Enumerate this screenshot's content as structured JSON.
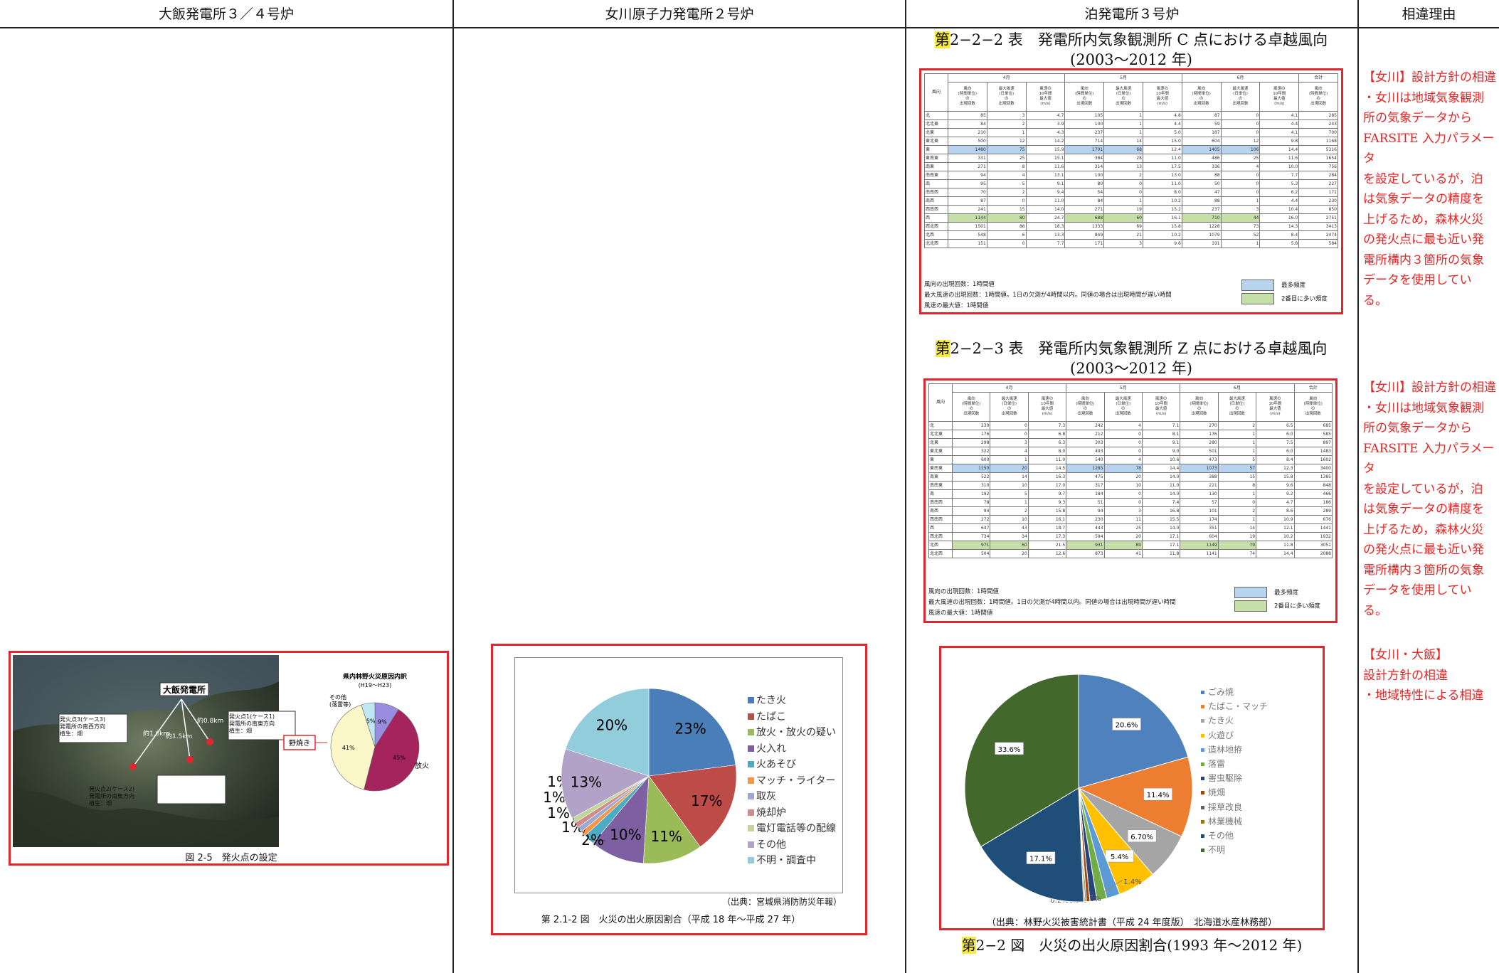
{
  "header": {
    "col1": "大飯発電所３／４号炉",
    "col2": "女川原子力発電所２号炉",
    "col3": "泊発電所３号炉",
    "col4": "相違理由"
  },
  "colors": {
    "accent_red": "#e0262e",
    "highlight": "#f6ea3a",
    "blue_cell": "#b7d3ee",
    "green_cell": "#c6dfa9"
  },
  "table1": {
    "hl": "第",
    "title": "2−2−2 表　発電所内気象観測所 C 点における卓越風向",
    "years": "(2003〜2012 年)"
  },
  "table2": {
    "hl": "第",
    "title": "2−2−3 表　発電所内気象観測所 Z 点における卓越風向",
    "years": "(2003〜2012 年)"
  },
  "wtable": {
    "corner": "風向",
    "months": [
      "4月",
      "5月",
      "6月",
      "合計"
    ],
    "sub": [
      "風向\n(時間単位)\nの\n出現回数",
      "最大風速\n(日単位)\nの\n出現回数",
      "風速の\n10年間\n最大値\n(m/s)"
    ],
    "sub_total": "風向\n(時間単位)\nの\n出現回数",
    "dirs": [
      "北",
      "北北東",
      "北東",
      "東北東",
      "東",
      "東南東",
      "南東",
      "南南東",
      "南",
      "南南西",
      "南西",
      "西南西",
      "西",
      "西北西",
      "北西",
      "北北西"
    ],
    "t1_blue_row": 4,
    "t1_green_row": 12,
    "t2_blue_row": 5,
    "t2_green_row": 14,
    "t1_rows": [
      [
        85,
        3,
        4.7,
        105,
        1,
        4.8,
        87,
        0,
        4.1,
        285
      ],
      [
        84,
        2,
        3.9,
        100,
        1,
        4.4,
        59,
        0,
        4.4,
        243
      ],
      [
        210,
        1,
        4.3,
        237,
        1,
        5.0,
        187,
        0,
        4.1,
        700
      ],
      [
        500,
        12,
        14.2,
        714,
        14,
        15.0,
        604,
        12,
        9.8,
        1168
      ],
      [
        1480,
        75,
        15.9,
        1701,
        68,
        12.4,
        1405,
        106,
        14.4,
        5316
      ],
      [
        331,
        25,
        15.1,
        384,
        28,
        11.0,
        486,
        25,
        11.6,
        1654
      ],
      [
        271,
        8,
        11.6,
        314,
        13,
        17.5,
        336,
        4,
        10.0,
        756
      ],
      [
        94,
        4,
        13.1,
        100,
        2,
        13.0,
        88,
        0,
        7.7,
        284
      ],
      [
        95,
        5,
        9.1,
        80,
        0,
        11.0,
        50,
        0,
        5.3,
        227
      ],
      [
        70,
        2,
        9.4,
        54,
        0,
        8.0,
        47,
        0,
        6.2,
        171
      ],
      [
        87,
        0,
        11.0,
        84,
        1,
        10.2,
        88,
        1,
        4.4,
        230
      ],
      [
        241,
        15,
        14.0,
        271,
        19,
        15.2,
        237,
        3,
        10.4,
        850
      ],
      [
        1144,
        80,
        24.7,
        688,
        60,
        16.1,
        710,
        44,
        16.0,
        2751
      ],
      [
        1501,
        88,
        18.3,
        1333,
        69,
        15.8,
        1228,
        73,
        14.3,
        3413
      ],
      [
        548,
        6,
        13.3,
        849,
        21,
        10.2,
        1079,
        52,
        8.4,
        2474
      ],
      [
        151,
        0,
        7.7,
        171,
        3,
        9.6,
        191,
        1,
        5.8,
        584
      ]
    ],
    "t2_rows": [
      [
        230,
        0,
        7.3,
        242,
        4,
        7.1,
        270,
        2,
        6.5,
        685
      ],
      [
        176,
        0,
        6.8,
        212,
        0,
        8.1,
        176,
        1,
        6.0,
        585
      ],
      [
        298,
        3,
        6.3,
        303,
        0,
        9.1,
        280,
        1,
        7.5,
        897
      ],
      [
        322,
        4,
        8.0,
        493,
        0,
        9.0,
        501,
        1,
        6.0,
        1483
      ],
      [
        600,
        1,
        11.0,
        540,
        4,
        10.6,
        473,
        5,
        8.4,
        1602
      ],
      [
        1150,
        20,
        14.5,
        1285,
        78,
        14.4,
        1073,
        57,
        12.3,
        3400
      ],
      [
        522,
        14,
        16.3,
        475,
        20,
        14.0,
        388,
        15,
        15.8,
        1385
      ],
      [
        310,
        10,
        17.0,
        317,
        10,
        11.0,
        221,
        8,
        9.6,
        848
      ],
      [
        192,
        5,
        9.7,
        184,
        0,
        14.0,
        130,
        1,
        9.2,
        466
      ],
      [
        78,
        1,
        9.3,
        51,
        0,
        7.4,
        57,
        0,
        4.7,
        186
      ],
      [
        94,
        2,
        15.8,
        94,
        3,
        16.8,
        101,
        2,
        8.6,
        289
      ],
      [
        272,
        10,
        16.1,
        230,
        11,
        15.5,
        174,
        1,
        10.9,
        676
      ],
      [
        647,
        43,
        18.7,
        443,
        25,
        14.0,
        351,
        14,
        12.1,
        1441
      ],
      [
        734,
        34,
        17.3,
        594,
        20,
        17.1,
        604,
        19,
        10.2,
        1932
      ],
      [
        971,
        60,
        21.5,
        931,
        89,
        17.1,
        1149,
        79,
        11.8,
        3051
      ],
      [
        504,
        20,
        12.6,
        873,
        41,
        11.8,
        1141,
        74,
        14.4,
        2088
      ]
    ],
    "note1": "風向の出現回数：1時間値",
    "note2": "最大風速の出現回数：1時間値。1日の欠測が4時間以内。同値の場合は出現時間が遅い時間",
    "note3": "風速の最大値：1時間値",
    "legend_blue": "最多頻度",
    "legend_green": "2番目に多い頻度"
  },
  "reasons": {
    "r1": "【女川】設計方針の相違\n・女川は地域気象観測\n所の気象データから\nFARSITE 入力パラメータ\nを設定しているが，泊\nは気象データの精度を\n上げるため，森林火災\nの発火点に最も近い発\n電所構内３箇所の気象\nデータを使用してい\nる。",
    "r2": "【女川】設計方針の相違\n・女川は地域気象観測\n所の気象データから\nFARSITE 入力パラメータ\nを設定しているが，泊\nは気象データの精度を\n上げるため，森林火災\nの発火点に最も近い発\n電所構内３箇所の気象\nデータを使用してい\nる。",
    "r3": "【女川・大飯】\n設計方針の相違\n・地域特性による相違"
  },
  "ohi": {
    "map_title": "大飯発電所",
    "p3": "発火点3(ケース3)\n発電所の南西方向\n植生：畑",
    "p2": "発火点2(ケース2)\n発電所の南東方向\n植生：畑",
    "p1": "発火点1(ケース1)\n発電所の南東方向\n植生：畑",
    "d1": "約1.6km",
    "d2": "約1.5km",
    "d3": "約0.8km",
    "pie_title": "県内林野火災原因内訳",
    "pie_sub": "(H19〜H23)",
    "l_other": "その他\n(落雷等)",
    "l_fire": "放火",
    "l_noyaki": "野焼き",
    "v9": "9%",
    "v5": "5%",
    "v41": "41%",
    "v45": "45%",
    "caption": "図 2-5　発火点の設定"
  },
  "onagawa": {
    "source": "（出典：宮城県消防防災年報）",
    "caption": "第 2.1-2 図　火災の出火原因割合（平成 18 年〜平成 27 年）",
    "legend": [
      "たき火",
      "たばこ",
      "放火・放火の疑い",
      "火入れ",
      "火あそび",
      "マッチ・ライター",
      "取灰",
      "焼却炉",
      "電灯電話等の配線",
      "その他",
      "不明・調査中"
    ],
    "colors": [
      "#4a7eb8",
      "#bd4b48",
      "#9bbb59",
      "#7e5fa1",
      "#4bacc6",
      "#f79646",
      "#9aaad1",
      "#d08b8a",
      "#c2d69b",
      "#b2a2c7",
      "#92cddc"
    ],
    "values": [
      23,
      17,
      11,
      10,
      2,
      1,
      1,
      1,
      1,
      13,
      20
    ],
    "labels": [
      "23%",
      "17%",
      "11%",
      "10%",
      "2%",
      "1%",
      "1%",
      "1%",
      "1%",
      "13%",
      "20%"
    ]
  },
  "tomari": {
    "source": "（出典：林野火災被害統計書（平成 24 年度版）　北海道水産林務部）",
    "caption_hl": "第",
    "caption": "2−2 図　火災の出火原因割合(1993 年〜2012 年)",
    "legend": [
      "ごみ焼",
      "たばこ・マッチ",
      "たき火",
      "火遊び",
      "造林地拵",
      "落雷",
      "害虫駆除",
      "焼畑",
      "採草改良",
      "林業機械",
      "その他",
      "不明"
    ],
    "colors": [
      "#4f81bd",
      "#ed7d31",
      "#a5a5a5",
      "#ffc000",
      "#5b9bd5",
      "#70ad47",
      "#264478",
      "#9e480e",
      "#636363",
      "#997300",
      "#1f4e79",
      "#43682b"
    ],
    "values": [
      20.6,
      11.4,
      6.7,
      5.4,
      1.9,
      1.4,
      1.0,
      0.5,
      0.2,
      0.2,
      17.1,
      33.6
    ],
    "labels": [
      "20.6%",
      "11.4%",
      "6.70%",
      "5.4%",
      "1.9%",
      "1.4%",
      "1.0%",
      "0.5%",
      "0.2%",
      "0.2%",
      "17.1%",
      "33.6%"
    ]
  }
}
